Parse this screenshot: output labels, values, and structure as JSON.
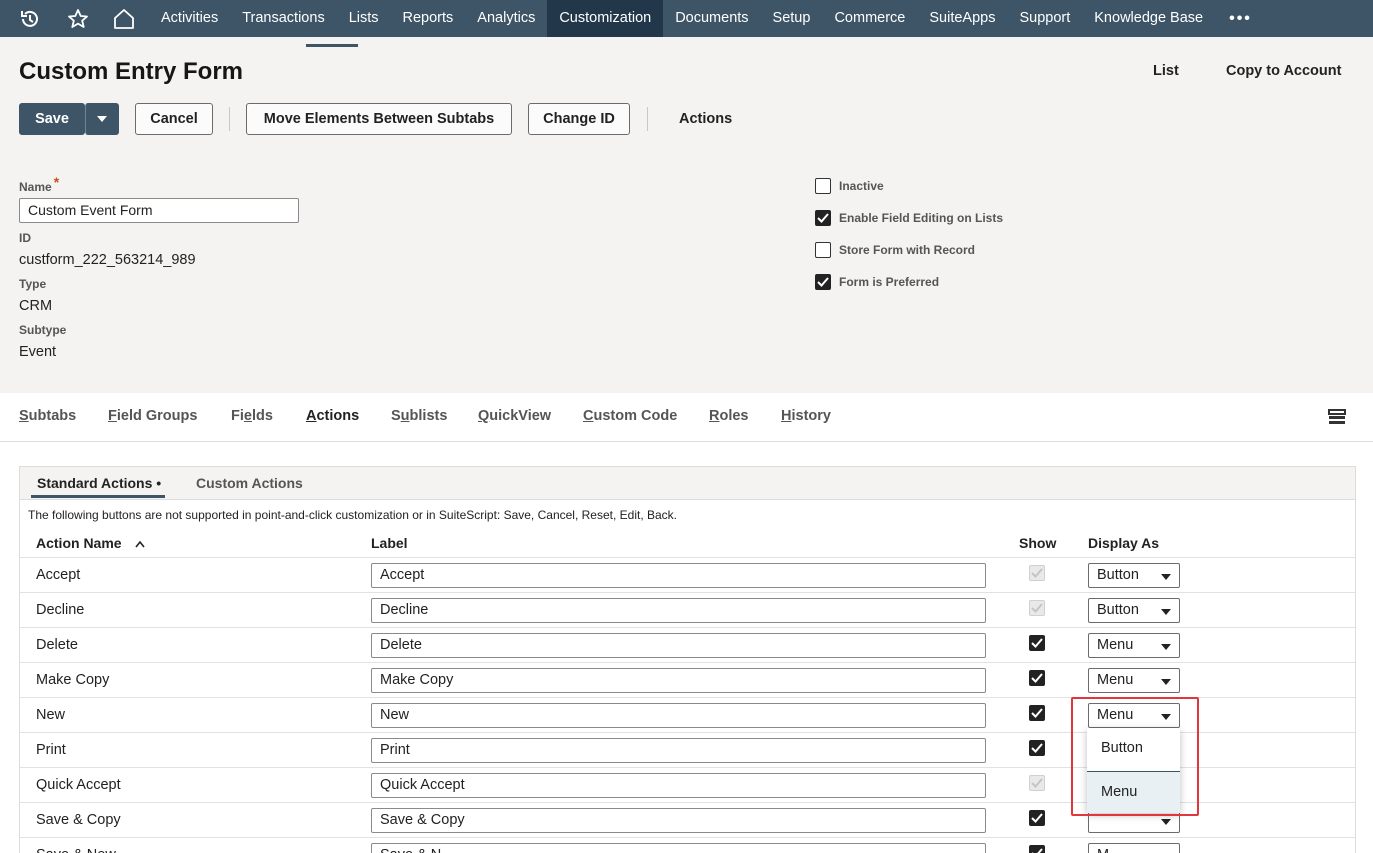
{
  "topnav": {
    "items": [
      "Activities",
      "Transactions",
      "Lists",
      "Reports",
      "Analytics",
      "Customization",
      "Documents",
      "Setup",
      "Commerce",
      "SuiteApps",
      "Support",
      "Knowledge Base"
    ],
    "active": "Customization",
    "more": "•••"
  },
  "header": {
    "title": "Custom Entry Form",
    "list_link": "List",
    "copy_link": "Copy to Account"
  },
  "toolbar": {
    "save": "Save",
    "cancel": "Cancel",
    "move_elements": "Move Elements Between Subtabs",
    "change_id": "Change ID",
    "actions": "Actions"
  },
  "form": {
    "name_label": "Name",
    "name_required": "*",
    "name_value": "Custom Event Form",
    "id_label": "ID",
    "id_value": "custform_222_563214_989",
    "type_label": "Type",
    "type_value": "CRM",
    "subtype_label": "Subtype",
    "subtype_value": "Event",
    "checkboxes": [
      {
        "label": "Inactive",
        "checked": false
      },
      {
        "label": "Enable Field Editing on Lists",
        "checked": true
      },
      {
        "label": "Store Form with Record",
        "checked": false
      },
      {
        "label": "Form is Preferred",
        "checked": true
      }
    ]
  },
  "subtabs": [
    {
      "first": "S",
      "rest": "ubtabs"
    },
    {
      "first": "F",
      "rest": "ield Groups"
    },
    {
      "pre": "Fi",
      "first": "e",
      "rest": "lds"
    },
    {
      "first": "A",
      "rest": "ctions"
    },
    {
      "pre": "S",
      "first": "u",
      "rest": "blists"
    },
    {
      "first": "Q",
      "rest": "uickView"
    },
    {
      "first": "C",
      "rest": "ustom Code"
    },
    {
      "first": "R",
      "rest": "oles"
    },
    {
      "first": "H",
      "rest": "istory"
    }
  ],
  "actions_panel": {
    "tab_standard": "Standard Actions •",
    "tab_custom": "Custom Actions",
    "notice": "The following buttons are not supported in point-and-click customization or in SuiteScript: Save, Cancel, Reset, Edit, Back.",
    "col_action_name": "Action Name",
    "col_label": "Label",
    "col_show": "Show",
    "col_display_as": "Display As",
    "rows": [
      {
        "name": "Accept",
        "label": "Accept",
        "show": "disabled",
        "display": "Button"
      },
      {
        "name": "Decline",
        "label": "Decline",
        "show": "disabled",
        "display": "Button"
      },
      {
        "name": "Delete",
        "label": "Delete",
        "show": "checked",
        "display": "Menu"
      },
      {
        "name": "Make Copy",
        "label": "Make Copy",
        "show": "checked",
        "display": "Menu"
      },
      {
        "name": "New",
        "label": "New",
        "show": "checked",
        "display": "Menu"
      },
      {
        "name": "Print",
        "label": "Print",
        "show": "checked",
        "display": ""
      },
      {
        "name": "Quick Accept",
        "label": "Quick Accept",
        "show": "disabled",
        "display": ""
      },
      {
        "name": "Save & Copy",
        "label": "Save & Copy",
        "show": "checked",
        "display": ""
      },
      {
        "name": "Save & New",
        "label": "Save & N",
        "show": "checked",
        "display": "M"
      }
    ],
    "dropdown_options": [
      "Button",
      "Menu"
    ],
    "dropdown_selected": "Menu"
  },
  "colors": {
    "nav_bg": "#3d5566",
    "nav_active": "#22384a",
    "highlight": "#e0373f"
  }
}
